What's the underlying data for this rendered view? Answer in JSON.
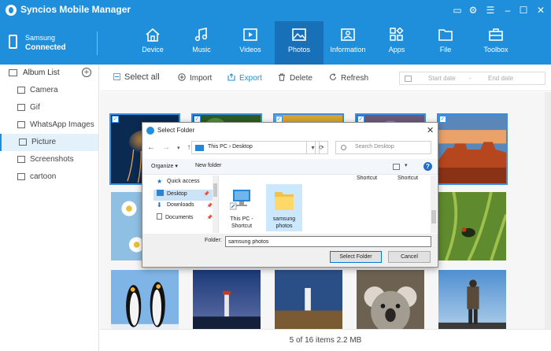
{
  "app": {
    "title": "Syncios Mobile Manager"
  },
  "device": {
    "name": "Samsung",
    "status": "Connected"
  },
  "nav": [
    {
      "label": "Device",
      "icon": "home-icon"
    },
    {
      "label": "Music",
      "icon": "music-icon"
    },
    {
      "label": "Videos",
      "icon": "video-icon"
    },
    {
      "label": "Photos",
      "icon": "photo-icon",
      "active": true
    },
    {
      "label": "Information",
      "icon": "contact-card-icon"
    },
    {
      "label": "Apps",
      "icon": "apps-icon"
    },
    {
      "label": "File",
      "icon": "folder-icon"
    },
    {
      "label": "Toolbox",
      "icon": "toolbox-icon"
    }
  ],
  "sidebar": {
    "header": "Album List",
    "items": [
      {
        "label": "Camera"
      },
      {
        "label": "Gif"
      },
      {
        "label": "WhatsApp Images"
      },
      {
        "label": "Picture",
        "active": true
      },
      {
        "label": "Screenshots"
      },
      {
        "label": "cartoon"
      }
    ]
  },
  "toolbar": {
    "select_all": "Select all",
    "import": "Import",
    "export": "Export",
    "delete": "Delete",
    "refresh": "Refresh",
    "start_date": "Start date",
    "date_separator": "-",
    "end_date": "End date"
  },
  "photos": [
    {
      "subject": "jellyfish",
      "selected": true
    },
    {
      "subject": "green plant",
      "selected": true
    },
    {
      "subject": "yellow flower",
      "selected": true
    },
    {
      "subject": "hydrangea",
      "selected": true
    },
    {
      "subject": "desert butte",
      "selected": true
    },
    {
      "subject": "daisies",
      "selected": false
    },
    {
      "subject": "flower field",
      "selected": false
    },
    {
      "subject": "tulips",
      "selected": false
    },
    {
      "subject": "tree",
      "selected": false
    },
    {
      "subject": "beetle on grass",
      "selected": false
    },
    {
      "subject": "penguins",
      "selected": false
    },
    {
      "subject": "lighthouse at dusk",
      "selected": false
    },
    {
      "subject": "lighthouse on rocks",
      "selected": false
    },
    {
      "subject": "koala",
      "selected": false
    },
    {
      "subject": "hiker",
      "selected": false
    }
  ],
  "status": {
    "text": "5 of 16 items 2.2 MB"
  },
  "dialog": {
    "title": "Select Folder",
    "breadcrumb": "This PC  ›  Desktop",
    "search_placeholder": "Search Desktop",
    "organize": "Organize ▾",
    "new_folder": "New folder",
    "nav_items": [
      {
        "label": "Quick access"
      },
      {
        "label": "Desktop",
        "selected": true
      },
      {
        "label": "Downloads"
      },
      {
        "label": "Documents"
      }
    ],
    "top_captions": [
      "Shortcut",
      "Shortcut"
    ],
    "files": [
      {
        "label": "This PC - Shortcut"
      },
      {
        "label": "samsung photos",
        "selected": true
      }
    ],
    "folder_label": "Folder:",
    "folder_value": "samsung photos",
    "select_button": "Select Folder",
    "cancel_button": "Cancel"
  },
  "colors": {
    "header_blue": "#1f8fdc",
    "active_tab": "#1870b9",
    "selection_blue": "#3a8fe0"
  }
}
